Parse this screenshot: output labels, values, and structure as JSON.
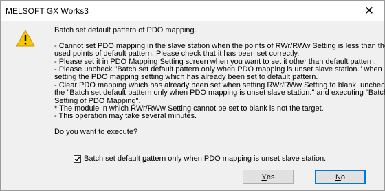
{
  "window": {
    "title": "MELSOFT GX Works3",
    "close_glyph": "✕"
  },
  "icon": {
    "name": "warning-icon",
    "color": "#f7c600"
  },
  "message": {
    "heading": "Batch set default pattern of PDO mapping.",
    "lines": [
      "- Cannot set PDO mapping in the slave station when the points of RWr/RWw Setting is less than the",
      "used points of default pattern. Please check that it has been set correctly.",
      "- Please set it in PDO Mapping Setting screen when you want to set it other than default pattern.",
      "- Please uncheck \"Batch set default pattern only when PDO mapping is unset slave station.\" when",
      "setting the PDO mapping setting which has already been set to default pattern.",
      "- Clear PDO mapping which has already been set when setting RWr/RWw Setting to blank, unchecking",
      "the \"Batch set default pattern only when PDO mapping is unset slave station.\" and executing \"Batch",
      "Setting of PDO Mapping\".",
      "* The module in which RWr/RWw Setting cannot be set to blank is not the target.",
      "- This operation may take several minutes."
    ],
    "question": "Do you want to execute?"
  },
  "checkbox": {
    "label_before": "Batch set default ",
    "label_underlined": "p",
    "label_after": "attern only when PDO mapping is unset slave station.",
    "checked": true
  },
  "buttons": {
    "yes_underlined": "Y",
    "yes_rest": "es",
    "no_underlined": "N",
    "no_rest": "o"
  }
}
